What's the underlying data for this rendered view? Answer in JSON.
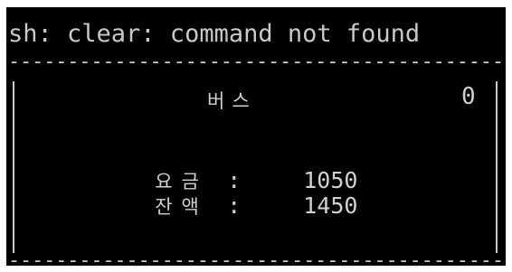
{
  "terminal": {
    "command_output": "sh: clear: command not found",
    "separator": "----------------------------------------------------",
    "title": "버스",
    "count": "0",
    "rows": [
      {
        "label": "요금",
        "colon": ":",
        "value": "1050"
      },
      {
        "label": "잔액",
        "colon": ":",
        "value": "1450"
      }
    ]
  },
  "colors": {
    "background": "#000000",
    "text": "#c8c8c8"
  }
}
